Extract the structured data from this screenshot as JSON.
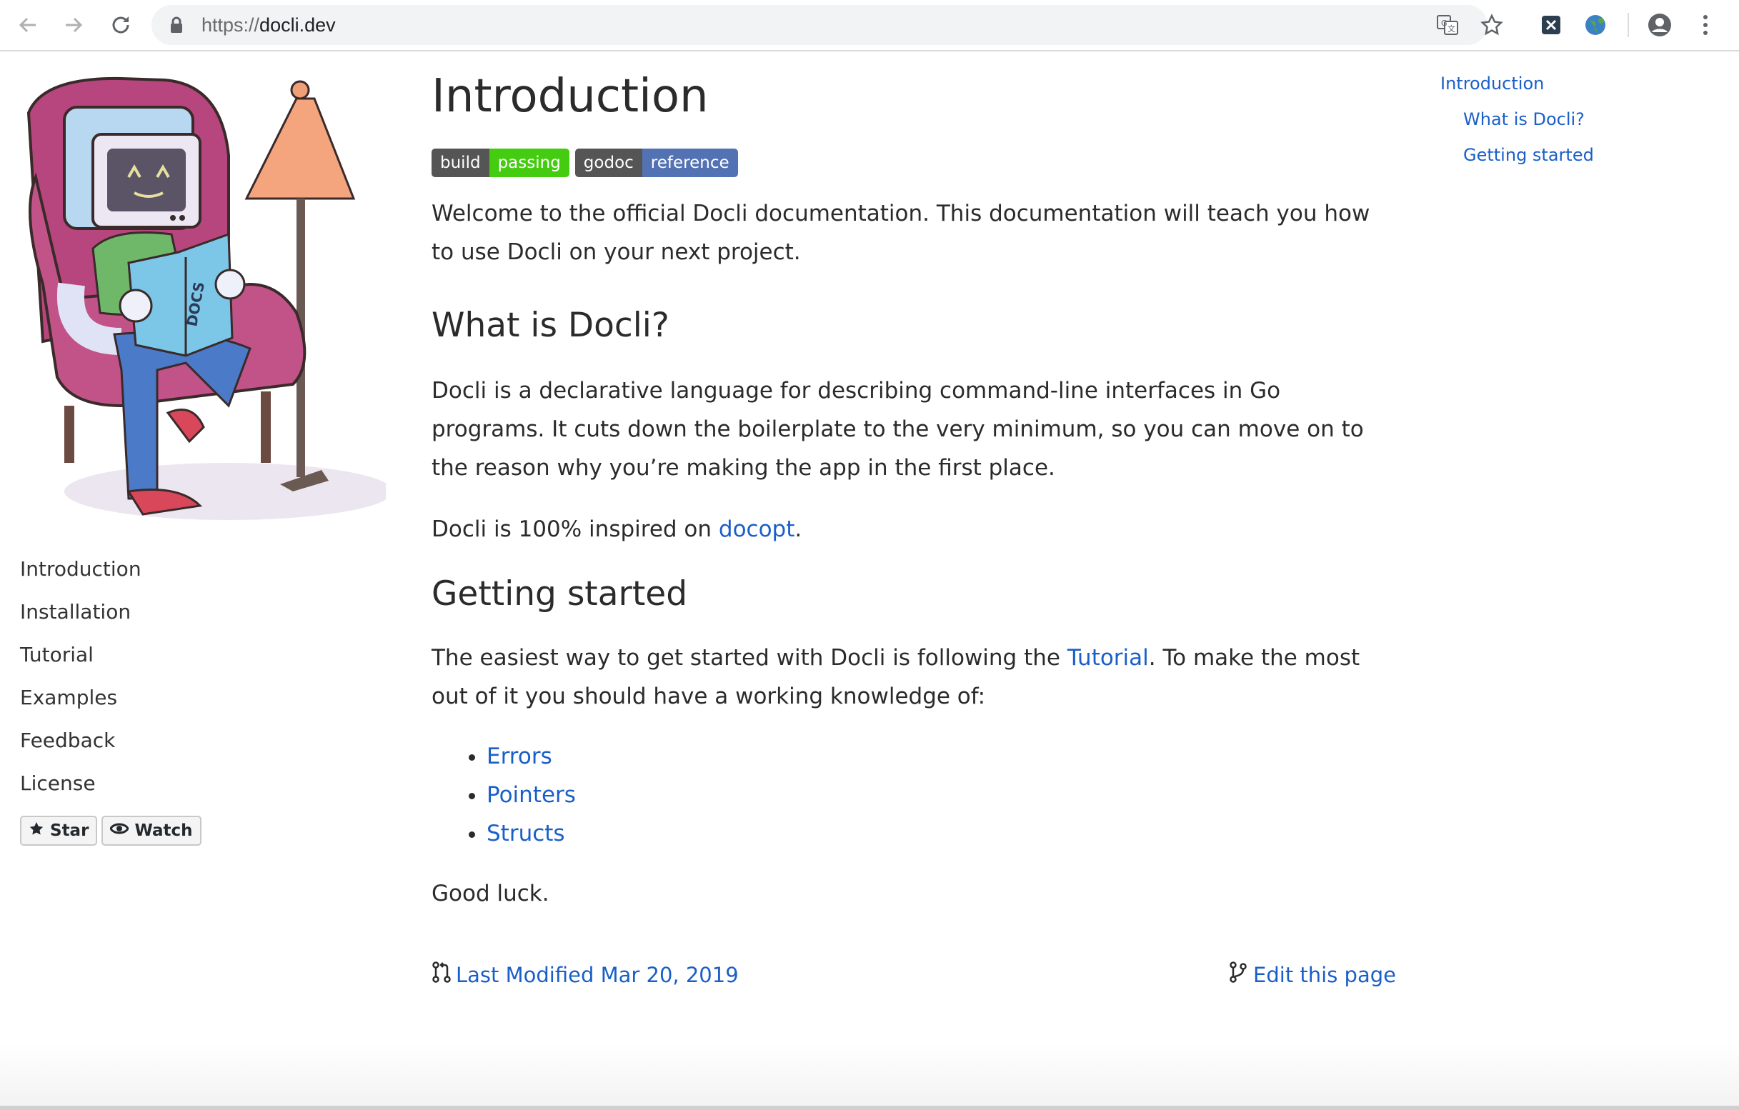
{
  "browser": {
    "url_scheme": "https://",
    "url_host": "docli.dev",
    "icons": [
      "back-icon",
      "forward-icon",
      "reload-icon",
      "lock-icon",
      "translate-icon",
      "star-icon",
      "extension-x-icon",
      "extension-globe-icon",
      "profile-icon",
      "menu-icon"
    ]
  },
  "sidebar": {
    "items": [
      {
        "label": "Introduction"
      },
      {
        "label": "Installation"
      },
      {
        "label": "Tutorial"
      },
      {
        "label": "Examples"
      },
      {
        "label": "Feedback"
      },
      {
        "label": "License"
      }
    ],
    "star_label": "Star",
    "watch_label": "Watch"
  },
  "content": {
    "title": "Introduction",
    "badges": [
      {
        "left": "build",
        "right": "passing",
        "color": "#44cc11"
      },
      {
        "left": "godoc",
        "right": "reference",
        "color": "#5272b4"
      }
    ],
    "welcome": "Welcome to the official Docli documentation. This documentation will teach you how to use Docli on your next project.",
    "what_heading": "What is Docli?",
    "what_body": "Docli is a declarative language for describing command-line interfaces in Go programs. It cuts down the boilerplate to the very minimum, so you can move on to the reason why you’re making the app in the first place.",
    "inspired_prefix": "Docli is 100% inspired on ",
    "inspired_link": "docopt",
    "inspired_suffix": ".",
    "started_heading": "Getting started",
    "started_prefix": "The easiest way to get started with Docli is following the ",
    "started_link": "Tutorial",
    "started_suffix": ". To make the most out of it you should have a working knowledge of:",
    "topics": [
      {
        "label": "Errors"
      },
      {
        "label": "Pointers"
      },
      {
        "label": "Structs"
      }
    ],
    "good_luck": "Good luck.",
    "last_modified": "Last Modified Mar 20, 2019",
    "edit_page": "Edit this page"
  },
  "toc": {
    "items": [
      {
        "label": "Introduction"
      },
      {
        "label": "What is Docli?"
      },
      {
        "label": "Getting started"
      }
    ]
  },
  "colors": {
    "link": "#1a5fc8",
    "text": "#2b2b2b"
  }
}
